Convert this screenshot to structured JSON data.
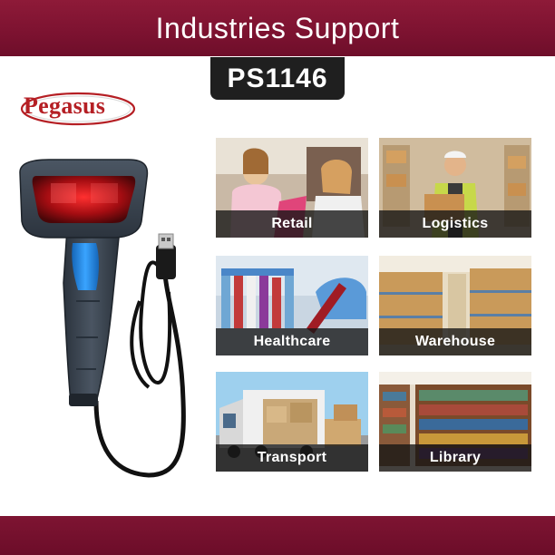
{
  "banner": {
    "title": "Industries Support"
  },
  "product": {
    "model": "PS1146"
  },
  "brand": {
    "name": "Pegasus"
  },
  "industries": [
    {
      "label": "Retail"
    },
    {
      "label": "Logistics"
    },
    {
      "label": "Healthcare"
    },
    {
      "label": "Warehouse"
    },
    {
      "label": "Transport"
    },
    {
      "label": "Library"
    }
  ],
  "colors": {
    "banner": "#7c1230",
    "tag": "#1f1f1f",
    "brand_red": "#b51f24",
    "scanner_body": "#3a4450",
    "scanner_accent": "#1f8fe0"
  },
  "icons": [
    "barcode-scanner-image",
    "usb-cable-image"
  ]
}
